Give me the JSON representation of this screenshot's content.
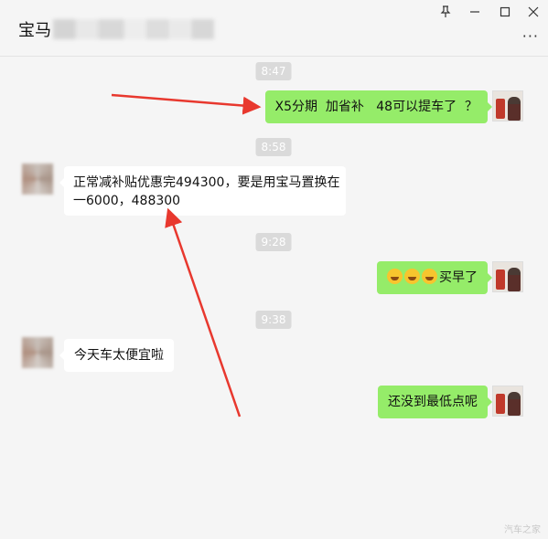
{
  "window": {
    "title": "宝马",
    "pin_icon": "pin-icon",
    "minimize_icon": "minimize-icon",
    "maximize_icon": "maximize-icon",
    "close_icon": "close-icon",
    "more_icon": "more-icon"
  },
  "colors": {
    "outgoing_bubble": "#95ec69",
    "incoming_bubble": "#ffffff",
    "annotation_arrow": "#e8382e",
    "timestamp_bg": "#dadada"
  },
  "messages": [
    {
      "type": "time",
      "text": "8:47"
    },
    {
      "type": "out",
      "text": "X5分期  加省补   48可以提车了  ？"
    },
    {
      "type": "time",
      "text": "8:58"
    },
    {
      "type": "in",
      "line1": "正常减补贴优惠完494300，要是用宝马置换在",
      "line2": "一6000，488300"
    },
    {
      "type": "time",
      "text": "9:28"
    },
    {
      "type": "out",
      "emoji": "laughing-crying-emoji",
      "text": "买早了"
    },
    {
      "type": "time",
      "text": "9:38"
    },
    {
      "type": "in",
      "text": "今天车太便宜啦"
    },
    {
      "type": "out",
      "text": "还没到最低点呢"
    }
  ],
  "watermark": "汽车之家"
}
